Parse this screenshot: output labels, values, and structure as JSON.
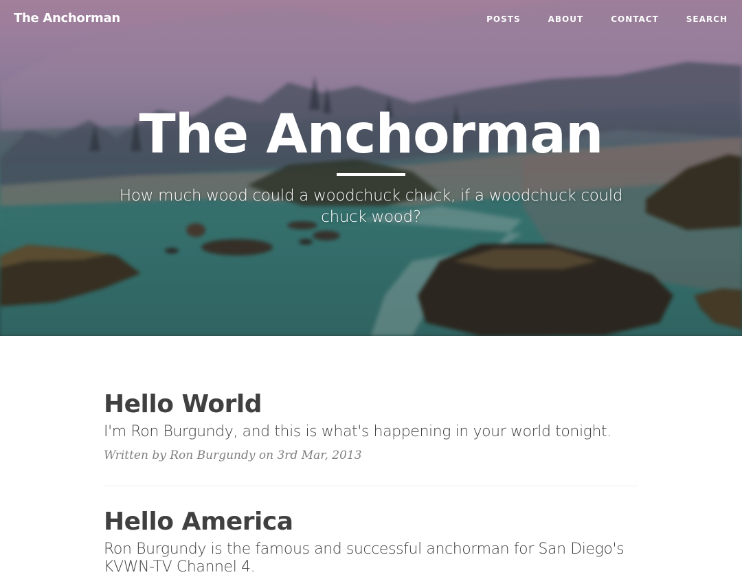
{
  "nav": {
    "brand": "The Anchorman",
    "links": [
      {
        "label": "POSTS"
      },
      {
        "label": "ABOUT"
      },
      {
        "label": "CONTACT"
      },
      {
        "label": "SEARCH"
      }
    ]
  },
  "hero": {
    "title": "The Anchorman",
    "subtitle": "How much wood could a woodchuck chuck, if a woodchuck could chuck wood?"
  },
  "posts": [
    {
      "title": "Hello World",
      "subtitle": "I'm Ron Burgundy, and this is what's happening in your world tonight.",
      "meta": "Written by Ron Burgundy on 3rd Mar, 2013"
    },
    {
      "title": "Hello America",
      "subtitle": "Ron Burgundy is the famous and successful anchorman for San Diego's KVWN-TV Channel 4."
    }
  ],
  "colors": {
    "text": "#404040",
    "meta": "#808080",
    "divider": "#eeeeee",
    "nav_text": "#ffffff"
  }
}
